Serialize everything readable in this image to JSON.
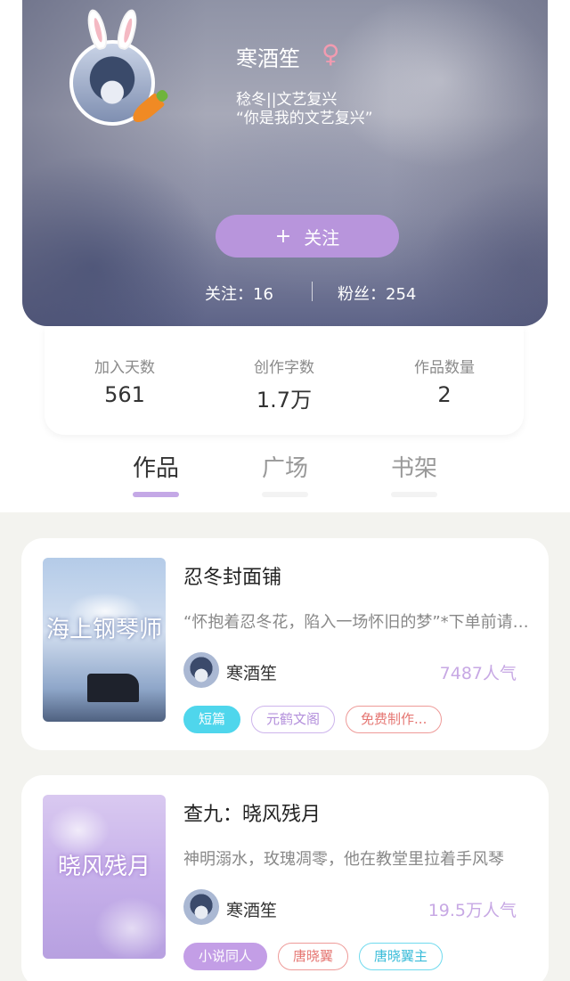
{
  "profile": {
    "name": "寒酒笙",
    "gender_icon": "female-icon",
    "gender_symbol": "♀",
    "bio_line1": "稔冬||文艺复兴",
    "bio_line2": "“你是我的文艺复兴”",
    "follow_plus": "+",
    "follow_label": "关注",
    "following": "关注：16",
    "fans": "粉丝：254"
  },
  "stats": [
    {
      "label": "加入天数",
      "value": "561"
    },
    {
      "label": "创作字数",
      "value": "1.7万"
    },
    {
      "label": "作品数量",
      "value": "2"
    }
  ],
  "tabs": [
    {
      "label": "作品",
      "active": true
    },
    {
      "label": "广场",
      "active": false
    },
    {
      "label": "书架",
      "active": false
    }
  ],
  "works": [
    {
      "title": "忍冬封面铺",
      "cover_text": "海上钢琴师",
      "description": "“怀抱着忍冬花，陷入一场怀旧的梦”*下单前请看置顶",
      "author": "寒酒笙",
      "popularity": "7487人气",
      "tags": [
        "短篇",
        "元鹤文阁",
        "免费制作..."
      ]
    },
    {
      "title": "查九：晓风残月",
      "cover_text": "晓风残月",
      "description": "神明溺水，玫瑰凋零，他在教堂里拉着手风琴",
      "author": "寒酒笙",
      "popularity": "19.5万人气",
      "tags": [
        "小说同人",
        "唐晓翼",
        "唐晓翼主"
      ]
    }
  ],
  "colors": {
    "accent_purple": "#b895dc",
    "tab_indicator": "#c4a8e6",
    "popularity": "#c7a8e4",
    "tag_cyan": "#4fd6ec",
    "tag_red": "#e57672"
  }
}
